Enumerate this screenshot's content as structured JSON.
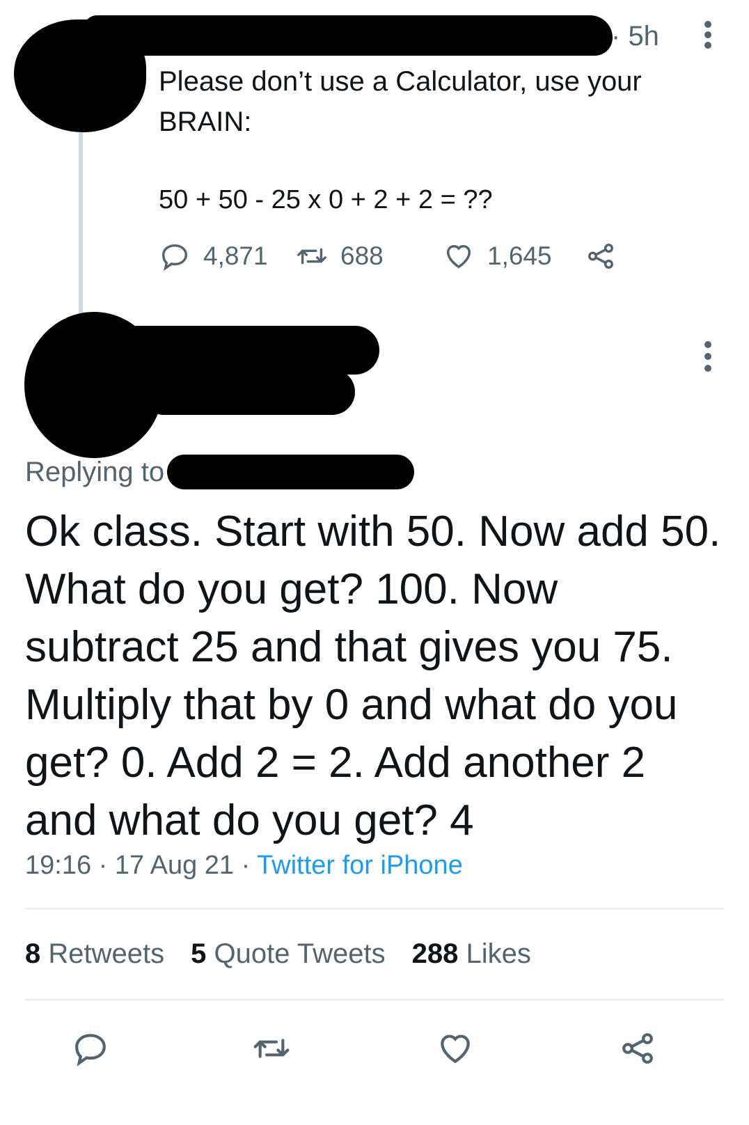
{
  "parent_tweet": {
    "time": "5h",
    "text_line1": "Please don’t use a Calculator, use your",
    "text_line2": "BRAIN:",
    "equation": "50 + 50 - 25 x 0 + 2 + 2 = ??",
    "replies": "4,871",
    "retweets": "688",
    "likes": "1,645"
  },
  "reply_tweet": {
    "replying_to": "Replying to",
    "body": "Ok class. Start with 50. Now add 50. What do you get? 100. Now subtract 25 and that gives you 75. Multiply that by 0 and what do you get? 0. Add 2 = 2. Add another 2 and what do you get? 4",
    "time": "19:16",
    "date": "17 Aug 21",
    "source": "Twitter for iPhone",
    "retweets_count": "8",
    "retweets_label": "Retweets",
    "quotes_count": "5",
    "quotes_label": "Quote Tweets",
    "likes_count": "288",
    "likes_label": "Likes"
  },
  "colors": {
    "text": "#0f1419",
    "muted": "#536471",
    "link": "#1d9bf0",
    "divider": "#e6ecf0"
  },
  "icons": [
    "reply-icon",
    "retweet-icon",
    "like-icon",
    "share-icon",
    "more-icon"
  ]
}
